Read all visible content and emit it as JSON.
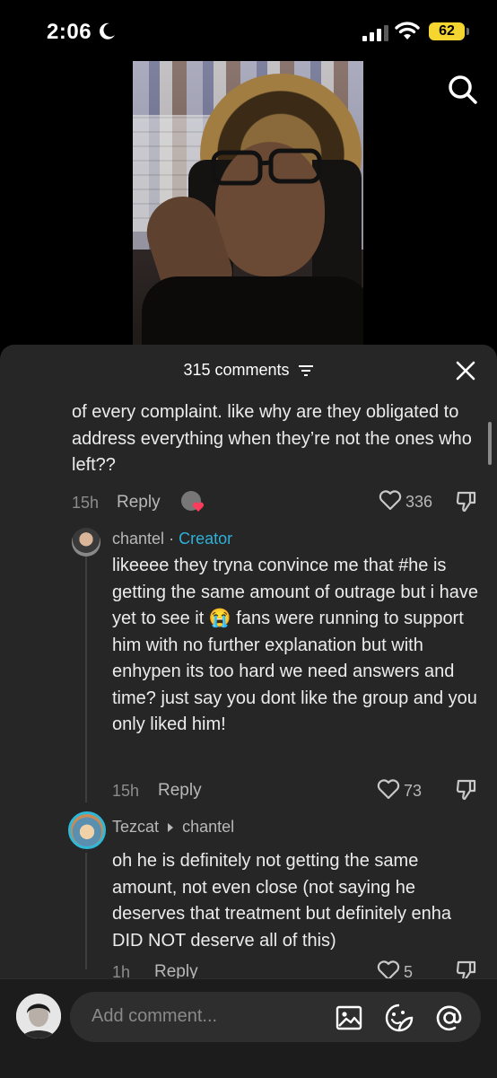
{
  "status": {
    "time": "2:06",
    "battery": "62"
  },
  "comments_header": {
    "count_label": "315 comments"
  },
  "comment1": {
    "text": "of every complaint. like why are they obligated to address everything when they’re not the ones who left??",
    "time": "15h",
    "reply_label": "Reply",
    "likes": "336"
  },
  "comment2": {
    "author": "chantel",
    "separator": "·",
    "badge": "Creator",
    "text": "likeeee they tryna convince me that #he is getting the same amount of outrage but i have yet to see it 😭 fans were running to support him with no further explanation but with enhypen its too hard we need answers and time? just say you dont like the group and you only liked him!",
    "time": "15h",
    "reply_label": "Reply",
    "likes": "73"
  },
  "comment3": {
    "author": "Tezcat",
    "reply_to": "chantel",
    "text": "oh he is definitely not getting the same amount, not even close (not saying he deserves that treatment but definitely enha DID NOT deserve all of this)",
    "time": "1h",
    "reply_label": "Reply",
    "likes": "5"
  },
  "composer": {
    "placeholder": "Add comment..."
  },
  "colors": {
    "sheet_bg": "#262626",
    "creator_accent": "#30b0d8",
    "heart_pink": "#ff3b5c",
    "battery": "#f5d631"
  }
}
